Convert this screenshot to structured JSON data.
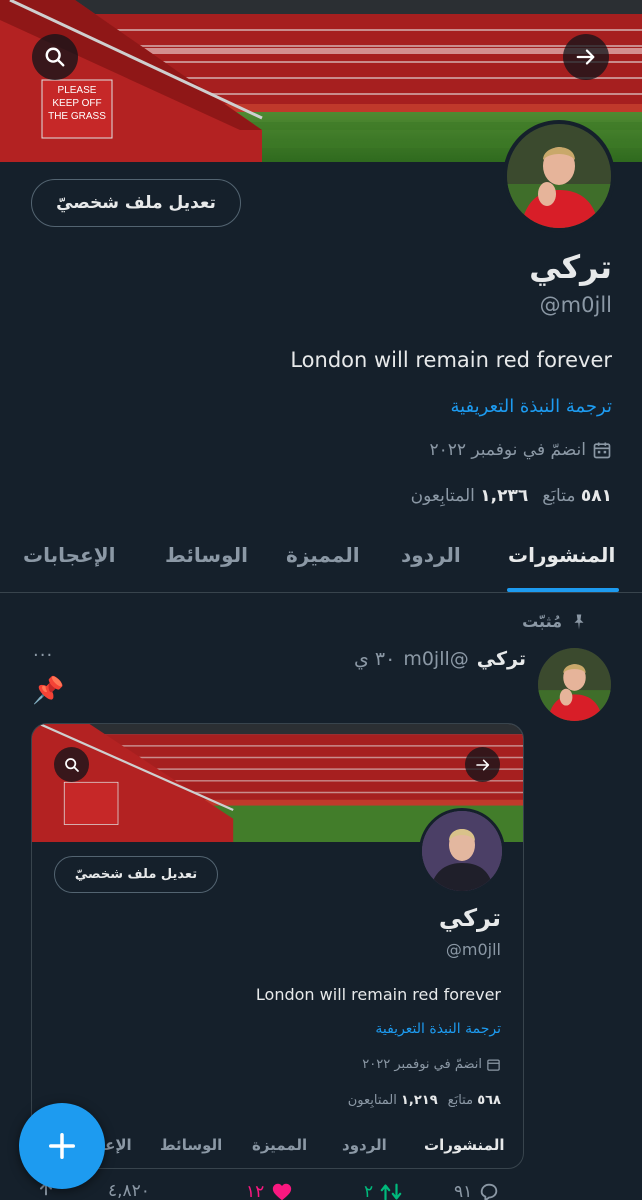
{
  "profile": {
    "display_name": "تركي",
    "handle": "@m0jll",
    "bio": "London will remain red forever",
    "translate_bio": "ترجمة النبذة التعريفية",
    "joined": "انضمّ في نوفمبر ٢٠٢٢",
    "following_count": "٥٨١",
    "following_label": "متابَع",
    "followers_count": "١,٢٣٦",
    "followers_label": "المتابِعون",
    "edit_profile": "تعديل ملف شخصيّ",
    "banner_sign": "PLEASE KEEP OFF THE GRASS"
  },
  "tabs": [
    "المنشورات",
    "الردود",
    "المميزة",
    "الوسائط",
    "الإعجابات"
  ],
  "pinned": {
    "label": "مُثبّت",
    "author_name": "تركي",
    "author_handle": "@m0jll",
    "time": "٣٠ ي",
    "pin_emoji": "📌",
    "more": "···"
  },
  "embedded": {
    "edit_profile": "تعديل ملف شخصيّ",
    "display_name": "تركي",
    "handle": "@m0jll",
    "bio": "London will remain red forever",
    "translate_bio": "ترجمة النبذة التعريفية",
    "joined": "انضمّ في نوفمبر ٢٠٢٢",
    "following_count": "٥٦٨",
    "following_label": "متابَع",
    "followers_count": "١,٢١٩",
    "followers_label": "المتابِعون",
    "tabs": [
      "المنشورات",
      "الردود",
      "المميزة",
      "الوسائط",
      "الإعـ"
    ]
  },
  "actions": {
    "replies": "٩١",
    "reposts": "٢",
    "likes": "١٢",
    "views": "٤,٨٢٠"
  },
  "icons": {
    "search": "search-icon",
    "share": "arrow-right-icon",
    "calendar": "calendar-icon",
    "pin": "pin-icon",
    "compose": "plus-icon"
  },
  "colors": {
    "background": "#15202b",
    "accent": "#1d9bf0",
    "muted": "#8b98a5",
    "repost": "#00ba7c",
    "like": "#f91880"
  }
}
